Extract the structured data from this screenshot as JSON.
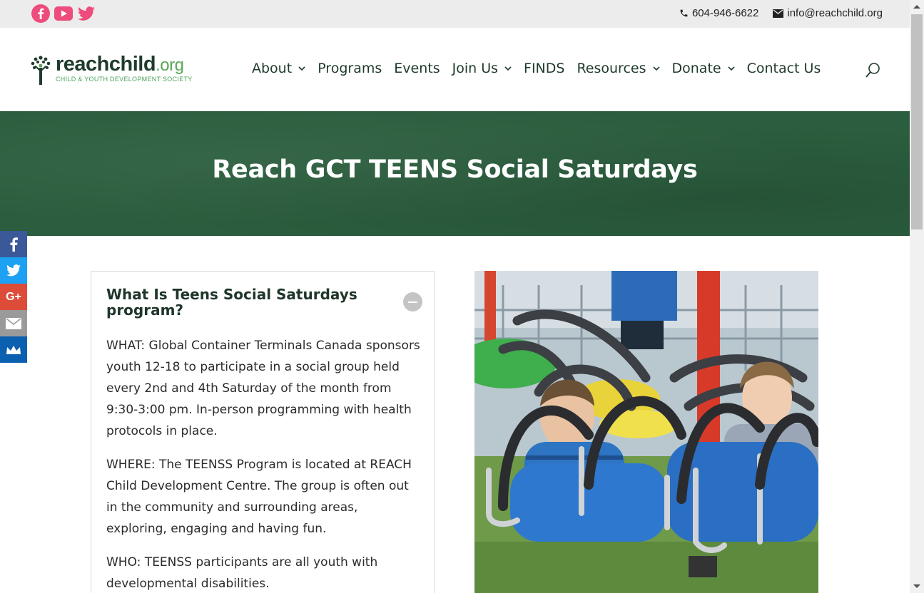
{
  "topbar": {
    "social_icons": [
      "facebook-icon",
      "youtube-icon",
      "twitter-icon"
    ],
    "phone": "604-946-6622",
    "email": "info@reachchild.org"
  },
  "logo": {
    "part1": "reach",
    "part2": "child",
    "part3": ".org",
    "tagline": "CHILD & YOUTH DEVELOPMENT SOCIETY"
  },
  "nav": {
    "items": [
      {
        "label": "About",
        "dropdown": true
      },
      {
        "label": "Programs",
        "dropdown": false
      },
      {
        "label": "Events",
        "dropdown": false
      },
      {
        "label": "Join Us",
        "dropdown": true
      },
      {
        "label": "FINDS",
        "dropdown": false
      },
      {
        "label": "Resources",
        "dropdown": true
      },
      {
        "label": "Donate",
        "dropdown": true
      },
      {
        "label": "Contact Us",
        "dropdown": false
      }
    ]
  },
  "hero": {
    "title": "Reach GCT TEENS Social Saturdays"
  },
  "share_bar": {
    "buttons": [
      {
        "icon": "facebook-icon",
        "color": "#3b5998"
      },
      {
        "icon": "twitter-icon",
        "color": "#1da1f2"
      },
      {
        "icon": "google-plus-icon",
        "color": "#dd4b39"
      },
      {
        "icon": "email-icon",
        "color": "#9a9a9a"
      },
      {
        "icon": "sumome-crown-icon",
        "color": "#0c60b0"
      }
    ],
    "gplus_label": "G+"
  },
  "accordion": {
    "title": "What Is Teens Social Saturdays program?",
    "paragraphs": [
      "WHAT: Global Container Terminals Canada sponsors youth 12-18 to participate in a social group held every 2nd and 4th Saturday of the month from 9:30-3:00 pm. In-person programming with health protocols in place.",
      "WHERE: The TEENSS Program is located at REACH Child Development Centre. The group is often out in the community and surrounding areas, exploring, engaging and having fun.",
      "WHO: TEENSS participants are all youth with developmental disabilities."
    ]
  },
  "colors": {
    "brand_green": "#2b5e3e",
    "nav_text": "#1e3a2a",
    "social_pink": "#ee4c7c"
  }
}
